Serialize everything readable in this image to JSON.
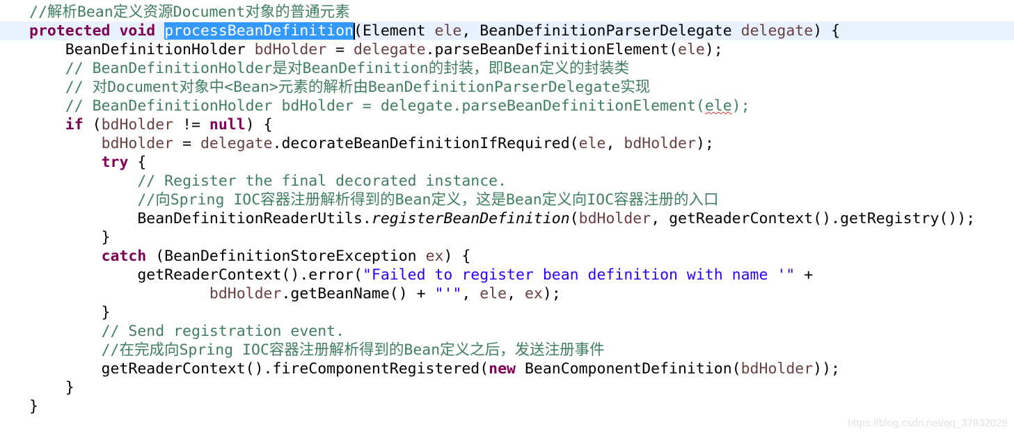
{
  "editor": {
    "language": "java",
    "colors": {
      "keyword": "#7f0055",
      "comment": "#3f7f5f",
      "variable": "#6a3e3e",
      "string": "#2a00ff",
      "selection": "#3399ff",
      "current_line": "#e8f2fe"
    },
    "current_line_index": 1,
    "lines": [
      [
        [
          "cm",
          "//解析Bean定义资源Document对象的普通元素"
        ]
      ],
      [
        [
          "kw",
          "protected"
        ],
        [
          "pl",
          " "
        ],
        [
          "kw",
          "void"
        ],
        [
          "pl",
          " "
        ],
        [
          "sel",
          "processBeanDefinition"
        ],
        [
          "caret",
          ""
        ],
        [
          "pl",
          "(Element "
        ],
        [
          "var",
          "ele"
        ],
        [
          "pl",
          ", BeanDefinitionParserDelegate "
        ],
        [
          "var",
          "delegate"
        ],
        [
          "pl",
          ") {"
        ]
      ],
      [
        [
          "pl",
          "    BeanDefinitionHolder "
        ],
        [
          "var",
          "bdHolder"
        ],
        [
          "pl",
          " = "
        ],
        [
          "var",
          "delegate"
        ],
        [
          "pl",
          ".parseBeanDefinitionElement("
        ],
        [
          "var",
          "ele"
        ],
        [
          "pl",
          ");"
        ]
      ],
      [
        [
          "pl",
          "    "
        ],
        [
          "cm",
          "// BeanDefinitionHolder是对BeanDefinition的封装，即Bean定义的封装类"
        ]
      ],
      [
        [
          "pl",
          "    "
        ],
        [
          "cm",
          "// 对Document对象中<Bean>元素的解析由BeanDefinitionParserDelegate实现"
        ]
      ],
      [
        [
          "pl",
          "    "
        ],
        [
          "cm",
          "// BeanDefinitionHolder bdHolder = delegate.parseBeanDefinitionElement("
        ],
        [
          "cmsq",
          "ele"
        ],
        [
          "cm",
          ");"
        ]
      ],
      [
        [
          "pl",
          "    "
        ],
        [
          "kw",
          "if"
        ],
        [
          "pl",
          " ("
        ],
        [
          "var",
          "bdHolder"
        ],
        [
          "pl",
          " != "
        ],
        [
          "kw",
          "null"
        ],
        [
          "pl",
          ") {"
        ]
      ],
      [
        [
          "pl",
          "        "
        ],
        [
          "var",
          "bdHolder"
        ],
        [
          "pl",
          " = "
        ],
        [
          "var",
          "delegate"
        ],
        [
          "pl",
          ".decorateBeanDefinitionIfRequired("
        ],
        [
          "var",
          "ele"
        ],
        [
          "pl",
          ", "
        ],
        [
          "var",
          "bdHolder"
        ],
        [
          "pl",
          ");"
        ]
      ],
      [
        [
          "pl",
          "        "
        ],
        [
          "kw",
          "try"
        ],
        [
          "pl",
          " {"
        ]
      ],
      [
        [
          "pl",
          "            "
        ],
        [
          "cm",
          "// Register the final decorated instance."
        ]
      ],
      [
        [
          "pl",
          "            "
        ],
        [
          "cm",
          "//向Spring IOC容器注册解析得到的Bean定义，这是Bean定义向IOC容器注册的入口"
        ]
      ],
      [
        [
          "pl",
          "            BeanDefinitionReaderUtils."
        ],
        [
          "it",
          "registerBeanDefinition"
        ],
        [
          "pl",
          "("
        ],
        [
          "var",
          "bdHolder"
        ],
        [
          "pl",
          ", getReaderContext().getRegistry());"
        ]
      ],
      [
        [
          "pl",
          "        }"
        ]
      ],
      [
        [
          "pl",
          "        "
        ],
        [
          "kw",
          "catch"
        ],
        [
          "pl",
          " (BeanDefinitionStoreException "
        ],
        [
          "var",
          "ex"
        ],
        [
          "pl",
          ") {"
        ]
      ],
      [
        [
          "pl",
          "            getReaderContext().error("
        ],
        [
          "str",
          "\"Failed to register bean definition with name '\""
        ],
        [
          "pl",
          " +"
        ]
      ],
      [
        [
          "pl",
          "                    "
        ],
        [
          "var",
          "bdHolder"
        ],
        [
          "pl",
          ".getBeanName() + "
        ],
        [
          "str",
          "\"'\""
        ],
        [
          "pl",
          ", "
        ],
        [
          "var",
          "ele"
        ],
        [
          "pl",
          ", "
        ],
        [
          "var",
          "ex"
        ],
        [
          "pl",
          ");"
        ]
      ],
      [
        [
          "pl",
          "        }"
        ]
      ],
      [
        [
          "pl",
          "        "
        ],
        [
          "cm",
          "// Send registration event."
        ]
      ],
      [
        [
          "pl",
          "        "
        ],
        [
          "cm",
          "//在完成向Spring IOC容器注册解析得到的Bean定义之后，发送注册事件"
        ]
      ],
      [
        [
          "pl",
          "        getReaderContext().fireComponentRegistered("
        ],
        [
          "kw",
          "new"
        ],
        [
          "pl",
          " BeanComponentDefinition("
        ],
        [
          "var",
          "bdHolder"
        ],
        [
          "pl",
          "));"
        ]
      ],
      [
        [
          "pl",
          "    }"
        ]
      ],
      [
        [
          "pl",
          "}"
        ]
      ]
    ]
  },
  "watermark": "https://blog.csdn.net/qq_37932029"
}
